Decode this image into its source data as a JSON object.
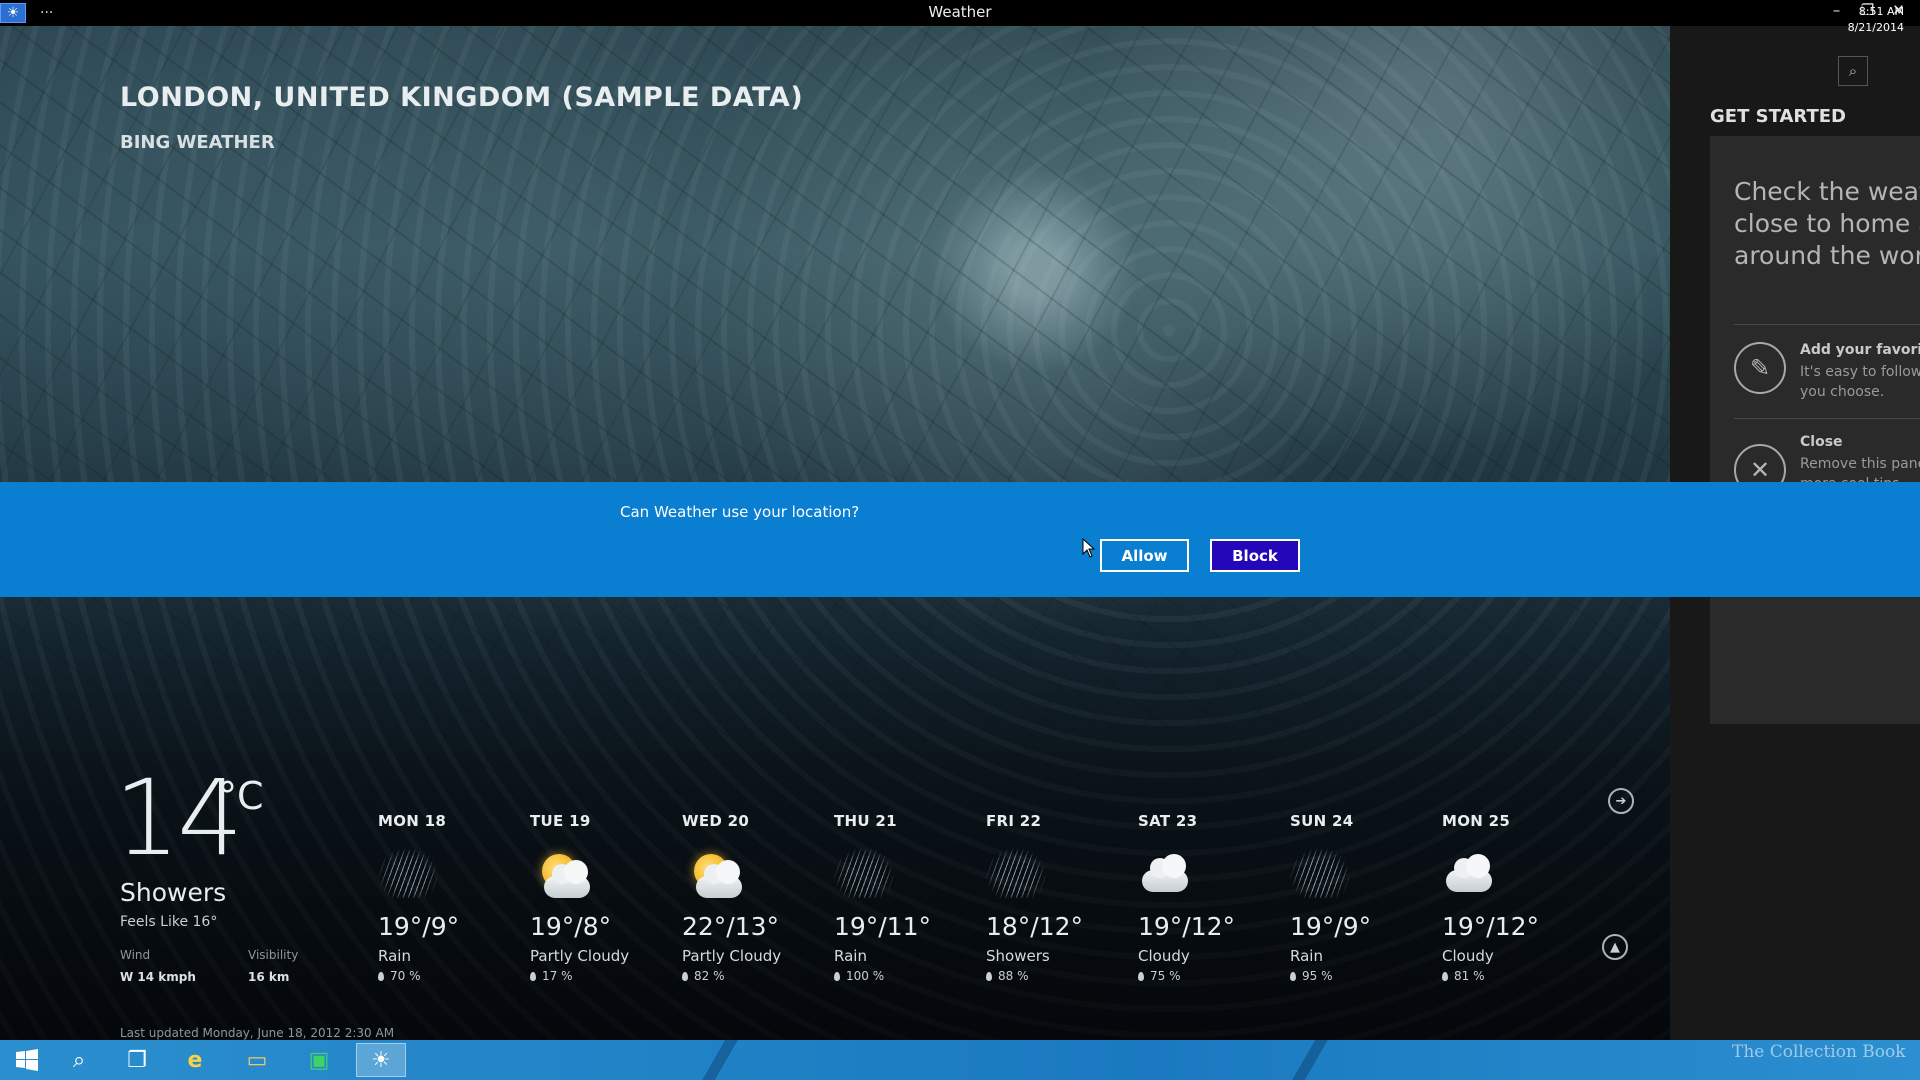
{
  "window": {
    "title": "Weather",
    "menu_dots": "···",
    "minimize": "–",
    "restore": "❐",
    "close": "✕"
  },
  "header": {
    "location": "LONDON, UNITED KINGDOM (SAMPLE DATA)",
    "provider": "BING WEATHER"
  },
  "current": {
    "temp": "14",
    "unit": "°C",
    "condition": "Showers",
    "feels_like": "Feels Like 16°",
    "wind_label": "Wind",
    "wind_value": "W 14 kmph",
    "visibility_label": "Visibility",
    "visibility_value": "16 km",
    "last_updated": "Last updated Monday, June 18, 2012 2:30 AM"
  },
  "forecast": [
    {
      "day": "MON 18",
      "temp": "19°/9°",
      "condition": "Rain",
      "precip": "70 %",
      "icon": "rain-icon"
    },
    {
      "day": "TUE 19",
      "temp": "19°/8°",
      "condition": "Partly Cloudy",
      "precip": "17 %",
      "icon": "partly-cloudy-icon"
    },
    {
      "day": "WED 20",
      "temp": "22°/13°",
      "condition": "Partly Cloudy",
      "precip": "82 %",
      "icon": "partly-cloudy-icon"
    },
    {
      "day": "THU 21",
      "temp": "19°/11°",
      "condition": "Rain",
      "precip": "100 %",
      "icon": "rain-icon"
    },
    {
      "day": "FRI 22",
      "temp": "18°/12°",
      "condition": "Showers",
      "precip": "88 %",
      "icon": "showers-icon"
    },
    {
      "day": "SAT 23",
      "temp": "19°/12°",
      "condition": "Cloudy",
      "precip": "75 %",
      "icon": "cloudy-icon"
    },
    {
      "day": "SUN 24",
      "temp": "19°/9°",
      "condition": "Rain",
      "precip": "95 %",
      "icon": "rain-icon"
    },
    {
      "day": "MON 25",
      "temp": "19°/12°",
      "condition": "Cloudy",
      "precip": "81 %",
      "icon": "cloudy-icon"
    }
  ],
  "pane": {
    "title": "GET STARTED",
    "intro": "Check the weather close to home and around the world.",
    "items": [
      {
        "title": "Add your favorites",
        "desc": "It's easy to follow the places you choose.",
        "icon": "pencil-icon"
      },
      {
        "title": "Close",
        "desc": "Remove this pane. Steps for more cool tips.",
        "icon": "close-circle-icon"
      }
    ]
  },
  "dialog": {
    "message": "Can Weather use your location?",
    "allow": "Allow",
    "block": "Block"
  },
  "taskbar": {
    "watermark": "The Collection Book",
    "time": "8:51 AM",
    "date": "8/21/2014"
  },
  "colors": {
    "dialog_bg": "#0a7ed1",
    "block_button": "#2307b8",
    "taskbar": "#1a79c0",
    "pane_bg": "#181818"
  }
}
